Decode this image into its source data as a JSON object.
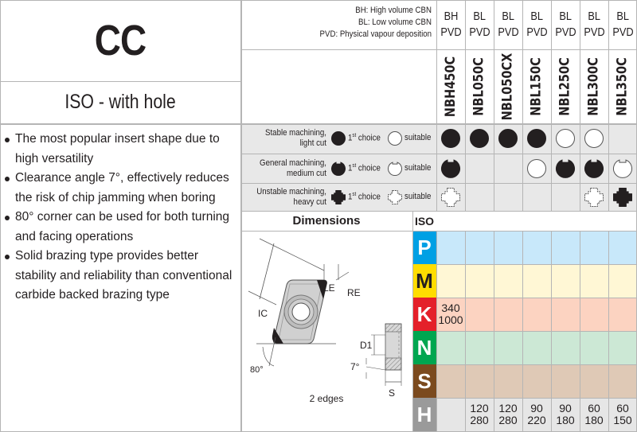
{
  "header": {
    "title": "CC",
    "subtitle": "ISO - with hole",
    "legend": [
      "BH: High volume CBN",
      "BL: Low volume CBN",
      "PVD: Physical vapour deposition"
    ]
  },
  "grades": [
    {
      "type": "BH",
      "coating": "PVD",
      "name": "NBH450C"
    },
    {
      "type": "BL",
      "coating": "PVD",
      "name": "NBL050C"
    },
    {
      "type": "BL",
      "coating": "PVD",
      "name": "NBL050CX"
    },
    {
      "type": "BL",
      "coating": "PVD",
      "name": "NBL150C"
    },
    {
      "type": "BL",
      "coating": "PVD",
      "name": "NBL250C"
    },
    {
      "type": "BL",
      "coating": "PVD",
      "name": "NBL300C"
    },
    {
      "type": "BL",
      "coating": "PVD",
      "name": "NBL350C"
    }
  ],
  "machining": {
    "first_choice_label": "1st choice",
    "first_choice_base": "1",
    "first_choice_sup": "st",
    "first_choice_rest": " choice",
    "suitable_label": "suitable",
    "rows": [
      {
        "label_line1": "Stable machining,",
        "label_line2": "light cut",
        "symbol": "circle",
        "cells": [
          "first",
          "first",
          "first",
          "first",
          "suitable",
          "suitable",
          ""
        ]
      },
      {
        "label_line1": "General machining,",
        "label_line2": "medium cut",
        "symbol": "notched",
        "cells": [
          "first",
          "",
          "",
          "suitable-circle",
          "first",
          "first",
          "suitable"
        ]
      },
      {
        "label_line1": "Unstable machining,",
        "label_line2": "heavy cut",
        "symbol": "cross",
        "cells": [
          "suitable",
          "",
          "",
          "",
          "",
          "suitable",
          "first"
        ]
      }
    ]
  },
  "features": [
    "The most popular insert shape due to high versatility",
    "Clearance angle 7°, effectively reduces the risk of chip jamming when boring",
    "80° corner can be used for both turning and facing operations",
    "Solid brazing type provides better stability and reliability than conventional carbide backed brazing type"
  ],
  "dimensions": {
    "header": "Dimensions",
    "labels": {
      "ic": "IC",
      "le": "LE",
      "re": "RE",
      "d1": "D1",
      "angle_clearance": "7°",
      "angle_corner": "80°",
      "s": "S"
    },
    "edges": "2 edges"
  },
  "iso": {
    "header": "ISO",
    "rows": [
      {
        "letter": "P",
        "color": "#00a0e4",
        "bg": "#c8e8fa",
        "letter_color": "#ffffff",
        "values": [
          "",
          "",
          "",
          "",
          "",
          "",
          ""
        ]
      },
      {
        "letter": "M",
        "color": "#ffdd00",
        "bg": "#fff7d5",
        "letter_color": "#231f20",
        "values": [
          "",
          "",
          "",
          "",
          "",
          "",
          ""
        ]
      },
      {
        "letter": "K",
        "color": "#e4202a",
        "bg": "#fcd3c1",
        "letter_color": "#ffffff",
        "values": [
          [
            "340",
            "1000"
          ],
          "",
          "",
          "",
          "",
          "",
          ""
        ]
      },
      {
        "letter": "N",
        "color": "#00a650",
        "bg": "#cce8d5",
        "letter_color": "#ffffff",
        "values": [
          "",
          "",
          "",
          "",
          "",
          "",
          ""
        ]
      },
      {
        "letter": "S",
        "color": "#7b4a1e",
        "bg": "#dfc9b6",
        "letter_color": "#ffffff",
        "values": [
          "",
          "",
          "",
          "",
          "",
          "",
          ""
        ]
      },
      {
        "letter": "H",
        "color": "#9a9a9a",
        "bg": "#e6e6e6",
        "letter_color": "#ffffff",
        "values": [
          "",
          [
            "120",
            "280"
          ],
          [
            "120",
            "280"
          ],
          [
            "90",
            "220"
          ],
          [
            "90",
            "180"
          ],
          [
            "60",
            "180"
          ],
          [
            "60",
            "150"
          ]
        ]
      }
    ]
  }
}
